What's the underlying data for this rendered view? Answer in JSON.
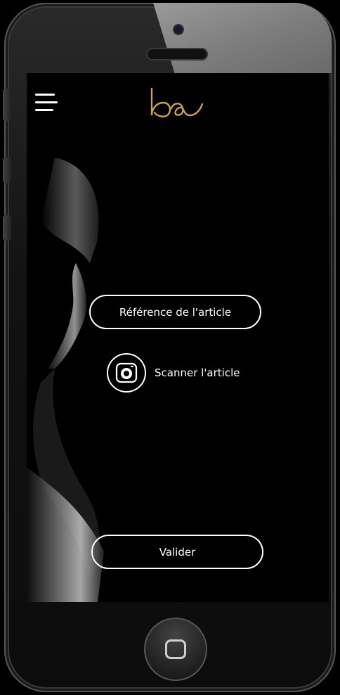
{
  "header": {
    "menu_icon": "hamburger-menu-icon",
    "logo_icon": "bau-logo-icon",
    "logo_color": "#c9a24b"
  },
  "form": {
    "reference_label": "Référence de l'article",
    "scan_label": "Scanner l'article",
    "scan_icon": "camera-icon",
    "submit_label": "Valider"
  },
  "device": {
    "home_icon": "home-button-icon"
  },
  "colors": {
    "background": "#000000",
    "text": "#ffffff",
    "accent": "#c9a24b"
  }
}
